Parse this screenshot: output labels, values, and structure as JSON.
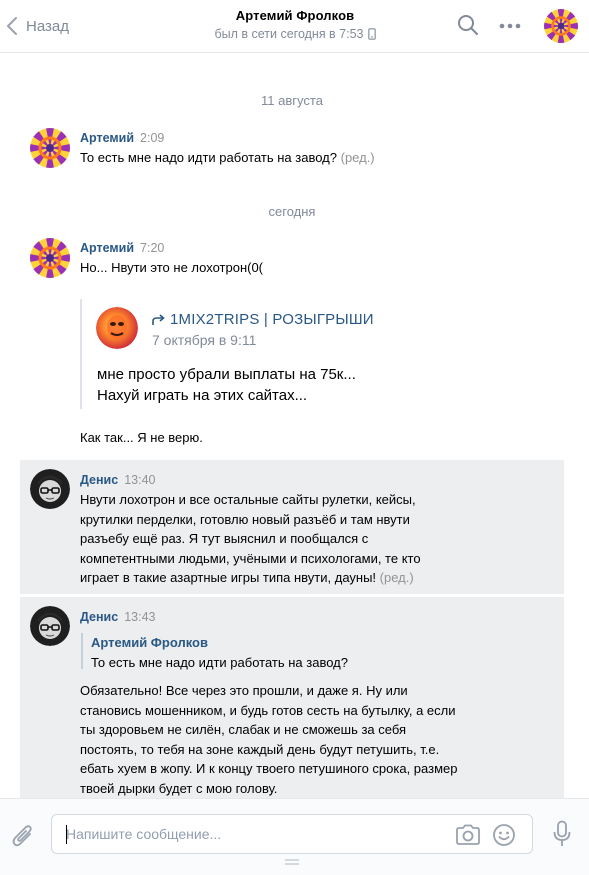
{
  "header": {
    "back_label": "Назад",
    "title": "Артемий Фролков",
    "status": "был в сети сегодня в 7:53"
  },
  "dates": {
    "first": "11 августа",
    "second": "сегодня"
  },
  "messages": [
    {
      "author": "Артемий",
      "time": "2:09",
      "text": "То есть мне надо идти работать на завод?",
      "edited": "(ред.)"
    },
    {
      "author": "Артемий",
      "time": "7:20",
      "text": "Но... Нвути это не лохотрон(0(",
      "forward": {
        "group": "1MIX2TRIPS | РОЗЫГРЫШИ",
        "date": "7 октября в 9:11",
        "lines": [
          "мне просто убрали выплаты на 75к...",
          "Нахуй играть на этих сайтах..."
        ]
      },
      "after_text": "Как так... Я не верю."
    },
    {
      "author": "Денис",
      "time": "13:40",
      "lines": [
        "Нвути лохотрон и все остальные сайты рулетки, кейсы,",
        "крутилки перделки, готовлю новый разъёб и там нвути",
        "разъебу ещё раз. Я тут выяснил и пообщался с",
        "компетентными людьми, учёными и психологами, те кто",
        "играет в такие азартные игры типа нвути, дауны!"
      ],
      "edited": "(ред.)"
    },
    {
      "author": "Денис",
      "time": "13:43",
      "reply": {
        "name": "Артемий Фролков",
        "text": "То есть мне надо идти работать на завод?"
      },
      "lines": [
        "Обязательно! Все через это прошли, и даже я. Ну или",
        "становись мошенником, и будь готов сесть на бутылку, а если",
        "ты здоровьем не силён, слабак и не сможешь за себя",
        "постоять, то тебя на зоне каждый день будут петушить, т.е.",
        "ебать хуем в жопу. И к концу твоего петушиного срока, размер",
        "твоей дырки будет с мою голову."
      ]
    }
  ],
  "composer": {
    "placeholder": "Напишите сообщение..."
  },
  "icons": {
    "back": "chevron-left-icon",
    "search": "search-icon",
    "more": "more-icon",
    "phone": "phone-icon",
    "attach": "paperclip-icon",
    "camera": "camera-icon",
    "emoji": "smile-icon",
    "mic": "microphone-icon"
  },
  "colors": {
    "link": "#2a5885",
    "muted": "#828a99",
    "highlight": "#edeef0"
  }
}
